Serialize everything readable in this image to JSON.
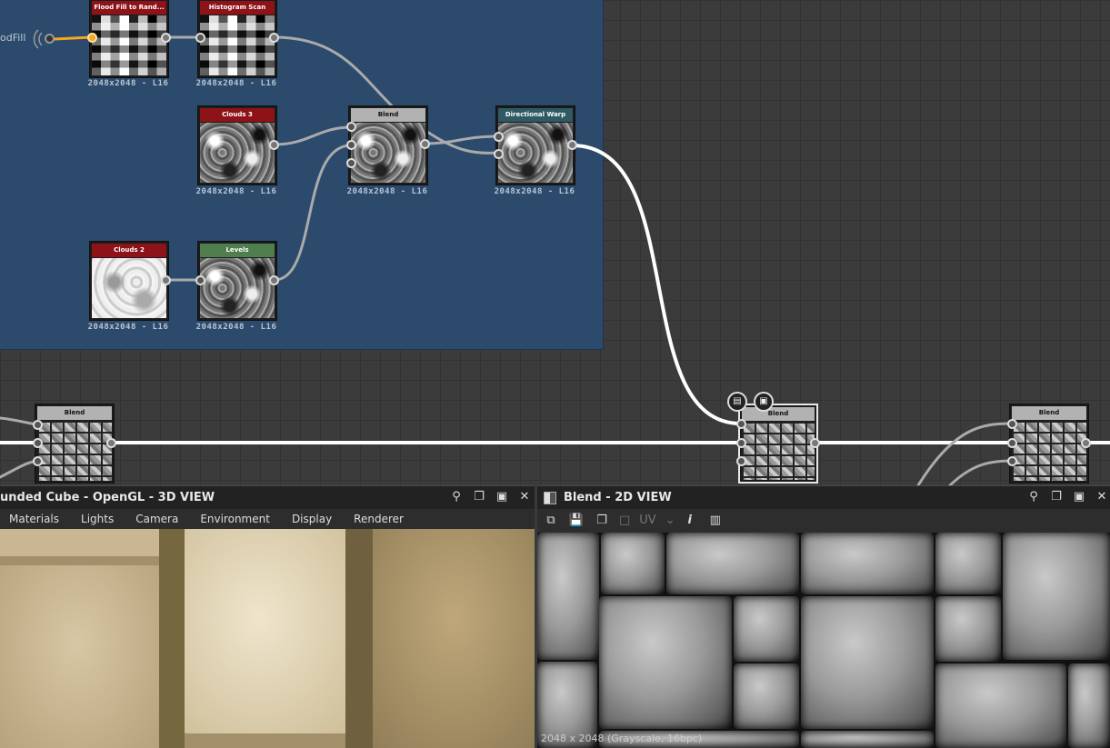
{
  "graph": {
    "frame_input_label": "odFill",
    "nodes": [
      {
        "id": "flood-fill-to-random",
        "title": "Flood Fill to Rand...",
        "resolution": "2048x2048 - L16"
      },
      {
        "id": "histogram-scan",
        "title": "Histogram Scan",
        "resolution": "2048x2048 - L16"
      },
      {
        "id": "clouds-3",
        "title": "Clouds 3",
        "resolution": "2048x2048 - L16"
      },
      {
        "id": "blend-inner",
        "title": "Blend",
        "resolution": "2048x2048 - L16"
      },
      {
        "id": "directional-warp",
        "title": "Directional Warp",
        "resolution": "2048x2048 - L16"
      },
      {
        "id": "clouds-2",
        "title": "Clouds 2",
        "resolution": "2048x2048 - L16"
      },
      {
        "id": "levels",
        "title": "Levels",
        "resolution": "2048x2048 - L16"
      },
      {
        "id": "blend-left",
        "title": "Blend"
      },
      {
        "id": "blend-selected",
        "title": "Blend"
      },
      {
        "id": "blend-right",
        "title": "Blend"
      }
    ]
  },
  "panel3d": {
    "title": "unded Cube - OpenGL - 3D VIEW",
    "menu": [
      "Materials",
      "Lights",
      "Camera",
      "Environment",
      "Display",
      "Renderer"
    ]
  },
  "panel2d": {
    "title": "Blend - 2D VIEW",
    "uv_label": "UV",
    "status": "2048 x 2048 (Grayscale, 16bpc)"
  },
  "colors": {
    "frame": "#2c4a6c",
    "header_red": "#8e1319",
    "header_grey": "#b2b2b2",
    "header_teal": "#2f5a64",
    "header_green": "#4f7f4f",
    "selection_accent": "#f5a623"
  },
  "icons": {
    "panel_controls": [
      "pin-icon",
      "float-icon",
      "maximize-icon",
      "close-icon"
    ],
    "toolbar2d": [
      "export-icon",
      "save-icon",
      "copy-icon",
      "uv-display-icon",
      "info-icon",
      "histogram-icon"
    ]
  }
}
